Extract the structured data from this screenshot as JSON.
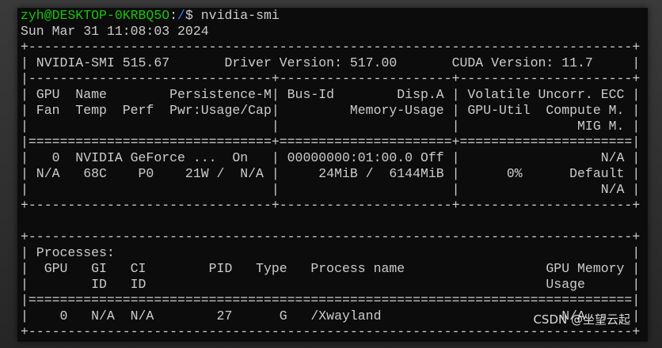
{
  "prompt": {
    "user_host": "zyh@DESKTOP-0KRBQ5O",
    "separator": ":",
    "path": "/",
    "symbol": "$ ",
    "command": "nvidia-smi"
  },
  "timestamp": "Sun Mar 31 11:08:03 2024",
  "smi_lines": [
    "+-----------------------------------------------------------------------------+",
    "| NVIDIA-SMI 515.67       Driver Version: 517.00       CUDA Version: 11.7     |",
    "|-------------------------------+----------------------+----------------------+",
    "| GPU  Name        Persistence-M| Bus-Id        Disp.A | Volatile Uncorr. ECC |",
    "| Fan  Temp  Perf  Pwr:Usage/Cap|         Memory-Usage | GPU-Util  Compute M. |",
    "|                               |                      |               MIG M. |",
    "|===============================+======================+======================|",
    "|   0  NVIDIA GeForce ...  On   | 00000000:01:00.0 Off |                  N/A |",
    "| N/A   68C    P0    21W /  N/A |     24MiB /  6144MiB |      0%      Default |",
    "|                               |                      |                  N/A |",
    "+-------------------------------+----------------------+----------------------+",
    "",
    "+-----------------------------------------------------------------------------+",
    "| Processes:                                                                  |",
    "|  GPU   GI   CI        PID   Type   Process name                  GPU Memory |",
    "|        ID   ID                                                   Usage      |",
    "|=============================================================================|",
    "|    0   N/A  N/A        27      G   /Xwayland                       N/A      |",
    "+-----------------------------------------------------------------------------+"
  ],
  "watermark": "CSDN @坐望云起"
}
